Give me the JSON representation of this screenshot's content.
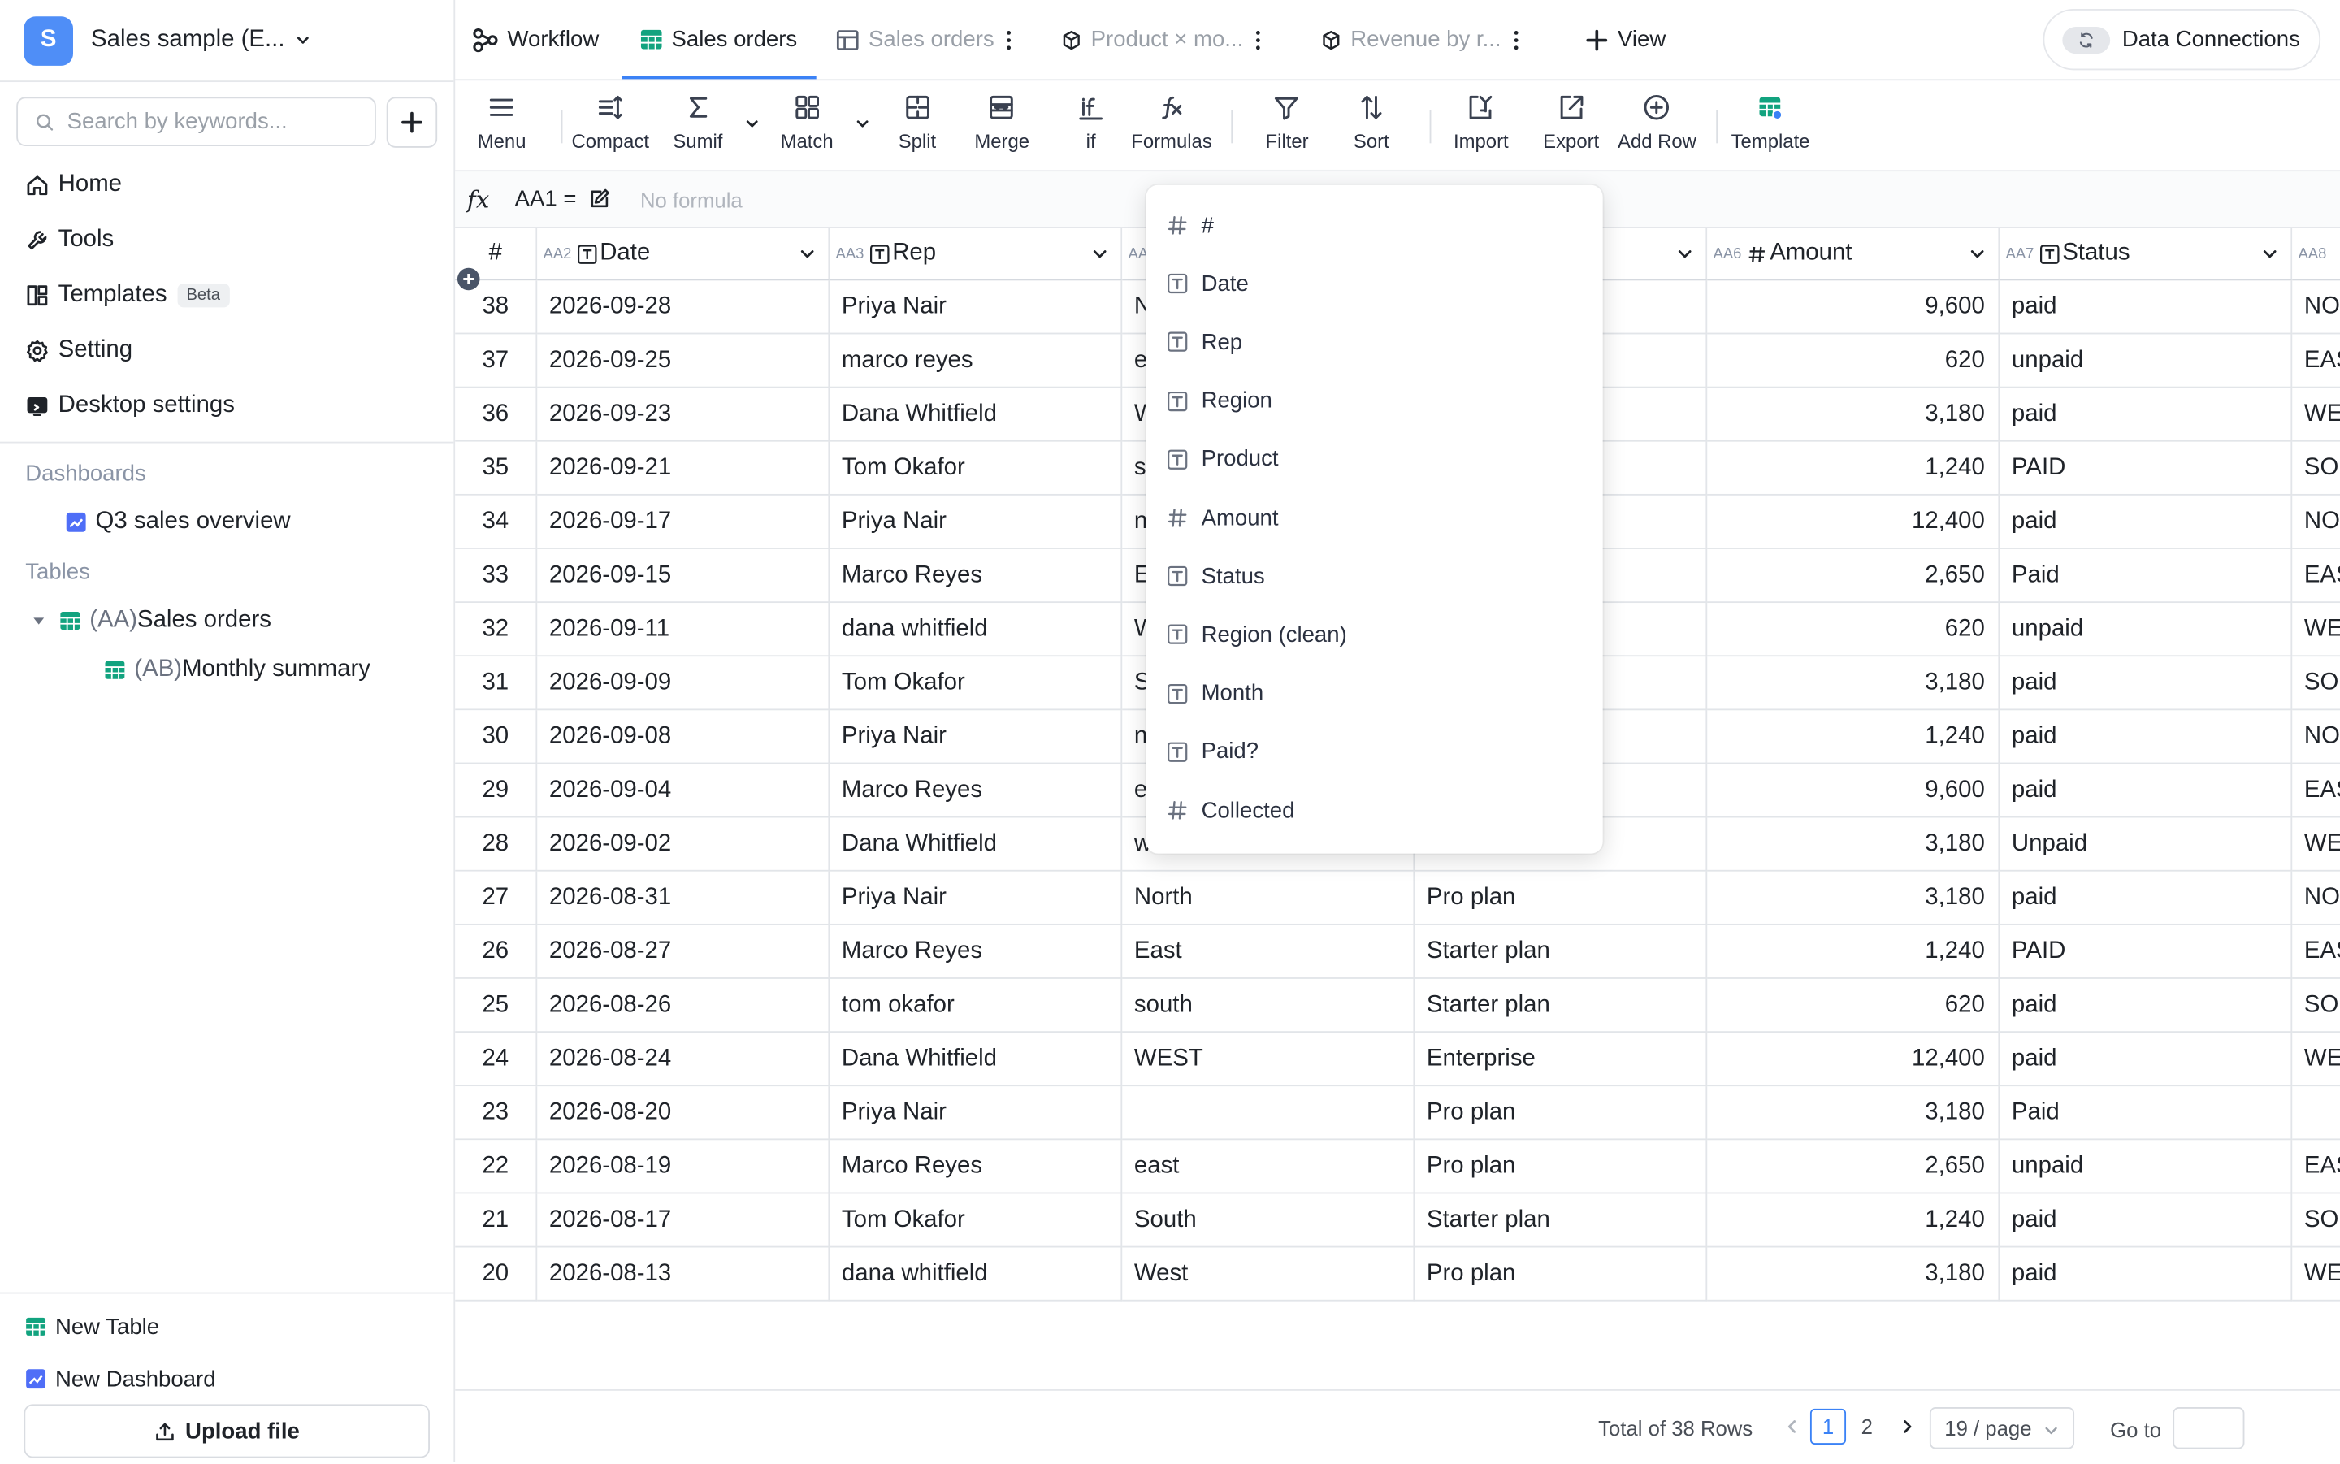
{
  "workspace": {
    "initial": "S",
    "name": "Sales sample (E...",
    "avatar_color": "#4f8ef7"
  },
  "search": {
    "placeholder": "Search by keywords..."
  },
  "sidebar": {
    "nav": [
      {
        "label": "Home",
        "icon": "home-icon"
      },
      {
        "label": "Tools",
        "icon": "wrench-icon"
      },
      {
        "label": "Templates",
        "icon": "templates-icon",
        "badge": "Beta"
      },
      {
        "label": "Setting",
        "icon": "gear-icon"
      },
      {
        "label": "Desktop settings",
        "icon": "desktop-icon"
      }
    ],
    "dashboards_label": "Dashboards",
    "dashboards": [
      {
        "label": "Q3 sales overview",
        "icon": "chart-icon"
      }
    ],
    "tables_label": "Tables",
    "tables": [
      {
        "prefix": "(AA)",
        "label": "Sales orders",
        "expanded": true
      },
      {
        "prefix": "(AB)",
        "label": "Monthly summary"
      }
    ],
    "new_table": "New Table",
    "new_dashboard": "New Dashboard",
    "upload": "Upload file"
  },
  "tabs": [
    {
      "label": "Workflow",
      "icon": "workflow-icon"
    },
    {
      "label": "Sales orders",
      "icon": "table-icon",
      "active": true
    },
    {
      "label": "Sales orders",
      "icon": "table-outline-icon"
    },
    {
      "label": "Product × mo...",
      "icon": "cube-icon"
    },
    {
      "label": "Revenue by r...",
      "icon": "cube-icon"
    }
  ],
  "add_view": "View",
  "data_connections": "Data Connections",
  "toolbar": {
    "menu": "Menu",
    "compact": "Compact",
    "sumif": "Sumif",
    "match": "Match",
    "split": "Split",
    "merge": "Merge",
    "if": "if",
    "formulas": "Formulas",
    "filter": "Filter",
    "sort": "Sort",
    "import": "Import",
    "export": "Export",
    "add_row": "Add Row",
    "template": "Template"
  },
  "formula_bar": {
    "fx": "fx",
    "cell_ref": "AA1 =",
    "placeholder": "No formula"
  },
  "columns": [
    {
      "id": "",
      "name": "#"
    },
    {
      "id": "AA2",
      "name": "Date",
      "type": "text"
    },
    {
      "id": "AA3",
      "name": "Rep",
      "type": "text"
    },
    {
      "id": "AA4",
      "name": "",
      "type": "text"
    },
    {
      "id": "",
      "name": "",
      "type": "text"
    },
    {
      "id": "AA6",
      "name": "Amount",
      "type": "number"
    },
    {
      "id": "AA7",
      "name": "Status",
      "type": "text"
    },
    {
      "id": "AA8",
      "name": "",
      "type": "text"
    }
  ],
  "rows": [
    {
      "n": "38",
      "date": "2026-09-28",
      "rep": "Priya Nair",
      "region": "N",
      "product": "",
      "amount": "9,600",
      "status": "paid",
      "extra": "NO"
    },
    {
      "n": "37",
      "date": "2026-09-25",
      "rep": "marco reyes",
      "region": "e",
      "product": "",
      "amount": "620",
      "status": "unpaid",
      "extra": "EAS"
    },
    {
      "n": "36",
      "date": "2026-09-23",
      "rep": "Dana Whitfield",
      "region": "W",
      "product": "",
      "amount": "3,180",
      "status": "paid",
      "extra": "WE"
    },
    {
      "n": "35",
      "date": "2026-09-21",
      "rep": "Tom Okafor",
      "region": "s",
      "product": "",
      "amount": "1,240",
      "status": "PAID",
      "extra": "SOU"
    },
    {
      "n": "34",
      "date": "2026-09-17",
      "rep": "Priya Nair",
      "region": "n",
      "product": "",
      "amount": "12,400",
      "status": "paid",
      "extra": "NO"
    },
    {
      "n": "33",
      "date": "2026-09-15",
      "rep": "Marco Reyes",
      "region": "E",
      "product": "",
      "amount": "2,650",
      "status": "Paid",
      "extra": "EAS"
    },
    {
      "n": "32",
      "date": "2026-09-11",
      "rep": "dana whitfield",
      "region": "W",
      "product": "",
      "amount": "620",
      "status": "unpaid",
      "extra": "WE"
    },
    {
      "n": "31",
      "date": "2026-09-09",
      "rep": "Tom Okafor",
      "region": "S",
      "product": "",
      "amount": "3,180",
      "status": "paid",
      "extra": "SOU"
    },
    {
      "n": "30",
      "date": "2026-09-08",
      "rep": "Priya Nair",
      "region": "n",
      "product": "",
      "amount": "1,240",
      "status": "paid",
      "extra": "NO"
    },
    {
      "n": "29",
      "date": "2026-09-04",
      "rep": "Marco Reyes",
      "region": "e",
      "product": "",
      "amount": "9,600",
      "status": "paid",
      "extra": "EAS"
    },
    {
      "n": "28",
      "date": "2026-09-02",
      "rep": "Dana Whitfield",
      "region": "w",
      "product": "",
      "amount": "3,180",
      "status": "Unpaid",
      "extra": "WE"
    },
    {
      "n": "27",
      "date": "2026-08-31",
      "rep": "Priya Nair",
      "region": "North",
      "product": "Pro plan",
      "amount": "3,180",
      "status": "paid",
      "extra": "NO"
    },
    {
      "n": "26",
      "date": "2026-08-27",
      "rep": "Marco Reyes",
      "region": "East",
      "product": "Starter plan",
      "amount": "1,240",
      "status": "PAID",
      "extra": "EAS"
    },
    {
      "n": "25",
      "date": "2026-08-26",
      "rep": "tom okafor",
      "region": "south",
      "product": "Starter plan",
      "amount": "620",
      "status": "paid",
      "extra": "SOU"
    },
    {
      "n": "24",
      "date": "2026-08-24",
      "rep": "Dana Whitfield",
      "region": "WEST",
      "product": "Enterprise",
      "amount": "12,400",
      "status": "paid",
      "extra": "WE"
    },
    {
      "n": "23",
      "date": "2026-08-20",
      "rep": "Priya Nair",
      "region": "",
      "product": "Pro plan",
      "amount": "3,180",
      "status": "Paid",
      "extra": ""
    },
    {
      "n": "22",
      "date": "2026-08-19",
      "rep": "Marco Reyes",
      "region": "east",
      "product": "Pro plan",
      "amount": "2,650",
      "status": "unpaid",
      "extra": "EAS"
    },
    {
      "n": "21",
      "date": "2026-08-17",
      "rep": "Tom Okafor",
      "region": "South",
      "product": "Starter plan",
      "amount": "1,240",
      "status": "paid",
      "extra": "SOU"
    },
    {
      "n": "20",
      "date": "2026-08-13",
      "rep": "dana whitfield",
      "region": "West",
      "product": "Pro plan",
      "amount": "3,180",
      "status": "paid",
      "extra": "WE"
    }
  ],
  "column_menu": [
    {
      "label": "#",
      "type": "number"
    },
    {
      "label": "Date",
      "type": "text"
    },
    {
      "label": "Rep",
      "type": "text"
    },
    {
      "label": "Region",
      "type": "text"
    },
    {
      "label": "Product",
      "type": "text"
    },
    {
      "label": "Amount",
      "type": "number"
    },
    {
      "label": "Status",
      "type": "text"
    },
    {
      "label": "Region (clean)",
      "type": "text"
    },
    {
      "label": "Month",
      "type": "text"
    },
    {
      "label": "Paid?",
      "type": "text"
    },
    {
      "label": "Collected",
      "type": "number"
    }
  ],
  "pagination": {
    "total": "Total of 38 Rows",
    "pages": [
      "1",
      "2"
    ],
    "current": "1",
    "per_page": "19 / page",
    "goto_label": "Go to"
  },
  "colors": {
    "accent": "#3b82f6",
    "table_icon": "#12a37f"
  }
}
